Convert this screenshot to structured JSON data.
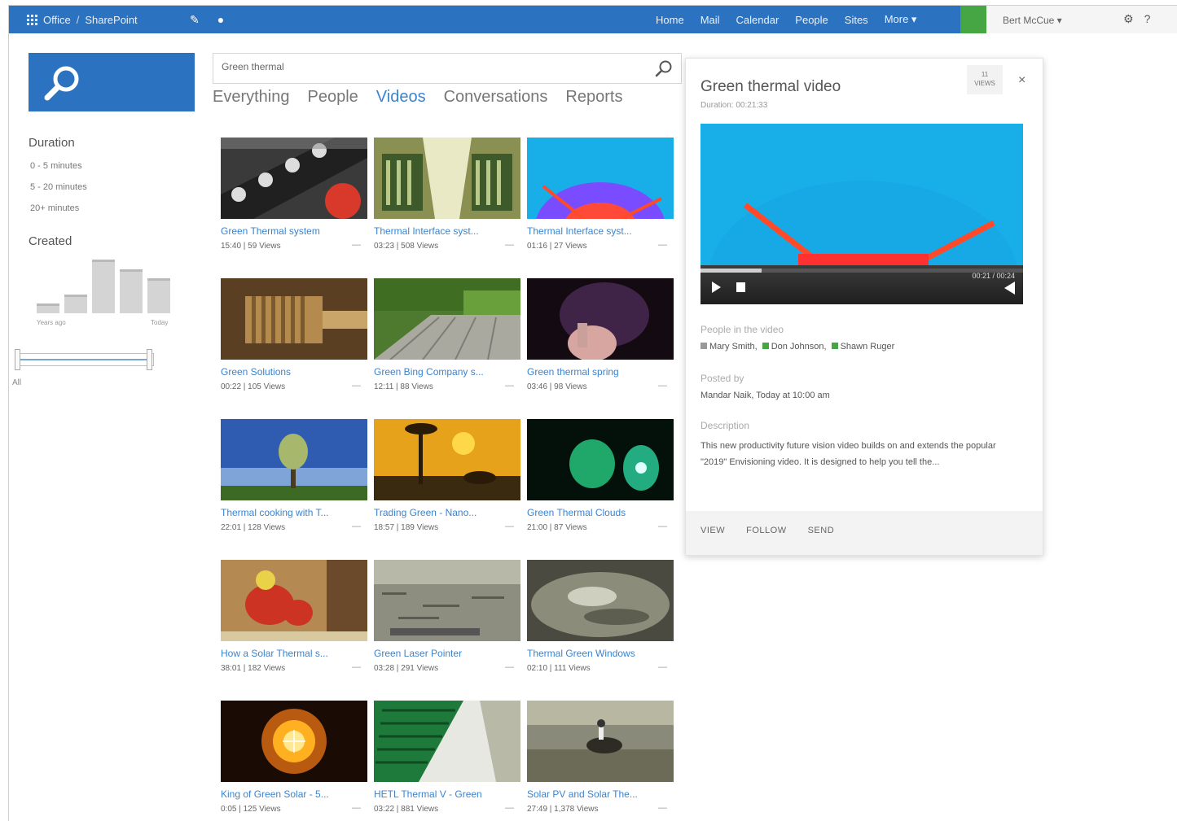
{
  "suitebar": {
    "brand_left": "Office",
    "brand_right": "SharePoint",
    "nav": [
      "Home",
      "Mail",
      "Calendar",
      "People",
      "Sites",
      "More ▾"
    ],
    "user": "Bert McCue ▾",
    "icons": [
      "gear-icon",
      "help-icon"
    ]
  },
  "search": {
    "query": "Green thermal",
    "tabs": [
      "Everything",
      "People",
      "Videos",
      "Conversations",
      "Reports"
    ],
    "active_tab": "Videos"
  },
  "refiners": {
    "duration_title": "Duration",
    "duration_items": [
      "0 - 5 minutes",
      "5 - 20 minutes",
      "20+ minutes"
    ],
    "created_title": "Created",
    "histogram": [
      3,
      6,
      17,
      14,
      11
    ],
    "axis_left": "Years ago",
    "axis_right": "Today",
    "slider_value": "All",
    "slider_range": [
      0,
      1
    ]
  },
  "videos": [
    {
      "title": "Green Thermal system",
      "meta": "15:40 | 59 Views",
      "thumb": "gears"
    },
    {
      "title": "Thermal Interface syst...",
      "meta": "03:23 | 508 Views",
      "thumb": "server"
    },
    {
      "title": "Thermal Interface syst...",
      "meta": "01:16 | 27 Views",
      "thumb": "heatmap"
    },
    {
      "title": "Green Solutions",
      "meta": "00:22 | 105 Views",
      "thumb": "bronze"
    },
    {
      "title": "Green Bing Company s...",
      "meta": "12:11 | 88 Views",
      "thumb": "garden"
    },
    {
      "title": "Green thermal spring",
      "meta": "03:46 | 98 Views",
      "thumb": "hand"
    },
    {
      "title": "Thermal cooking with T...",
      "meta": "22:01 | 128 Views",
      "thumb": "tree"
    },
    {
      "title": "Trading Green - Nano...",
      "meta": "18:57 | 189 Views",
      "thumb": "sunset"
    },
    {
      "title": "Green Thermal Clouds",
      "meta": "21:00 | 87 Views",
      "thumb": "green"
    },
    {
      "title": "How a Solar Thermal s...",
      "meta": "38:01 | 182 Views",
      "thumb": "worker"
    },
    {
      "title": "Green Laser Pointer",
      "meta": "03:28 | 291 Views",
      "thumb": "field"
    },
    {
      "title": "Thermal Green Windows",
      "meta": "02:10 | 111 Views",
      "thumb": "moon"
    },
    {
      "title": "King of Green Solar - 5...",
      "meta": "0:05 | 125 Views",
      "thumb": "sun"
    },
    {
      "title": "HETL Thermal V - Green",
      "meta": "03:22 | 881 Views",
      "thumb": "stripes"
    },
    {
      "title": "Solar PV and Solar The...",
      "meta": "27:49 | 1,378 Views",
      "thumb": "horse"
    }
  ],
  "video_more": "—",
  "panel": {
    "title": "Green thermal video",
    "subtitle": "Duration: 00:21:33",
    "views_count": "11",
    "views_label": "VIEWS",
    "close": "×",
    "timecode": "00:21 / 00:24",
    "progress": 0.19,
    "people_label": "People in the video",
    "people": [
      "Mary Smith",
      "Don Johnson",
      "Shawn Ruger"
    ],
    "posted_label": "Posted by",
    "posted_text": "Mandar Naik, Today at 10:00 am",
    "desc_label": "Description",
    "desc_text": "This new productivity future vision video builds on and extends the popular \"2019\" Envisioning video. It is designed to help you tell the...",
    "actions": [
      "VIEW",
      "FOLLOW",
      "SEND"
    ]
  }
}
